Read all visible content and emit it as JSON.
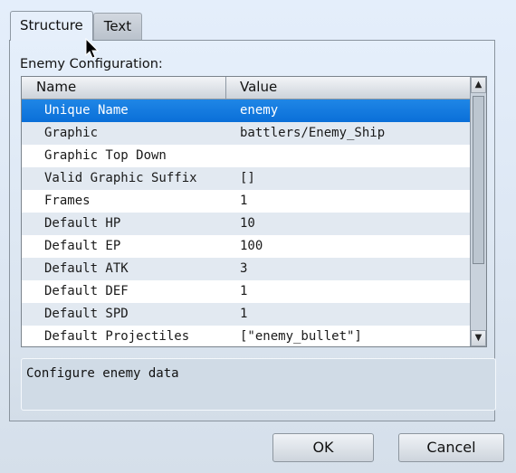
{
  "tabs": [
    {
      "label": "Structure",
      "active": true
    },
    {
      "label": "Text",
      "active": false
    }
  ],
  "section_label": "Enemy Configuration:",
  "grid": {
    "columns": [
      "Name",
      "Value"
    ],
    "rows": [
      {
        "name": "Unique Name",
        "value": "enemy",
        "selected": true
      },
      {
        "name": "Graphic",
        "value": "battlers/Enemy_Ship"
      },
      {
        "name": "Graphic Top Down",
        "value": ""
      },
      {
        "name": "Valid Graphic Suffix",
        "value": "[]"
      },
      {
        "name": "Frames",
        "value": "1"
      },
      {
        "name": "Default HP",
        "value": "10"
      },
      {
        "name": "Default EP",
        "value": "100"
      },
      {
        "name": "Default ATK",
        "value": "3"
      },
      {
        "name": "Default DEF",
        "value": "1"
      },
      {
        "name": "Default SPD",
        "value": "1"
      },
      {
        "name": "Default Projectiles",
        "value": "[\"enemy_bullet\"]"
      }
    ],
    "scroll_up_icon": "▲",
    "scroll_down_icon": "▼"
  },
  "description": "Configure enemy data",
  "buttons": {
    "ok": "OK",
    "cancel": "Cancel"
  },
  "colors": {
    "selection": "#0a6fd8",
    "alt_row": "#e2e9f1"
  }
}
